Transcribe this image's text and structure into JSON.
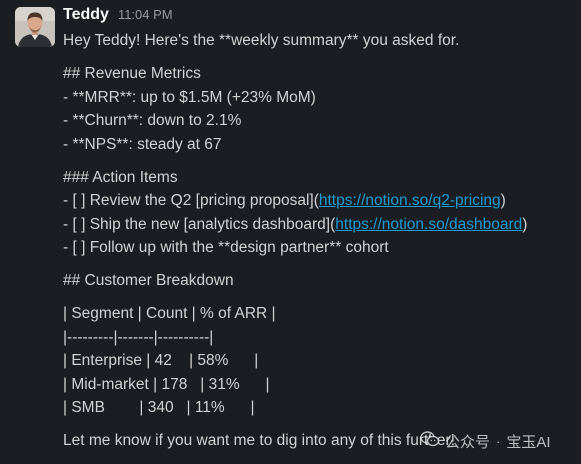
{
  "message": {
    "sender": "Teddy",
    "timestamp": "11:04 PM",
    "lines": {
      "intro": "Hey Teddy! Here's the **weekly summary** you asked for.",
      "h_revenue": "## Revenue Metrics",
      "mrr": "- **MRR**: up to $1.5M (+23% MoM)",
      "churn": "- **Churn**: down to 2.1%",
      "nps": "- **NPS**: steady at 67",
      "h_actions": "### Action Items",
      "action1_pre": "- [ ] Review the Q2 [pricing proposal](",
      "action1_link": "https://notion.so/q2-pricing",
      "action1_post": ")",
      "action2_pre": "- [ ] Ship the new [analytics dashboard](",
      "action2_link": "https://notion.so/dashboard",
      "action2_post": ")",
      "action3": "- [ ] Follow up with the **design partner** cohort",
      "h_customers": "## Customer Breakdown",
      "table_header": "| Segment | Count | % of ARR |",
      "table_sep": "|---------|-------|----------|",
      "row_enterprise": "| Enterprise | 42    | 58%      |",
      "row_midmarket": "| Mid-market | 178   | 31%      |",
      "row_smb": "| SMB        | 340   | 11%      |",
      "closing": "Let me know if you want me to dig into any of this further!"
    }
  },
  "watermark": {
    "label": "公众号",
    "name": "宝玉AI",
    "separator": "·"
  },
  "colors": {
    "background": "#1a1d21",
    "text": "#d1d2d3",
    "link": "#1d9bd1",
    "timestamp": "#9a9b9e"
  },
  "icons": {
    "avatar": "user-photo",
    "watermark": "wechat-icon"
  }
}
